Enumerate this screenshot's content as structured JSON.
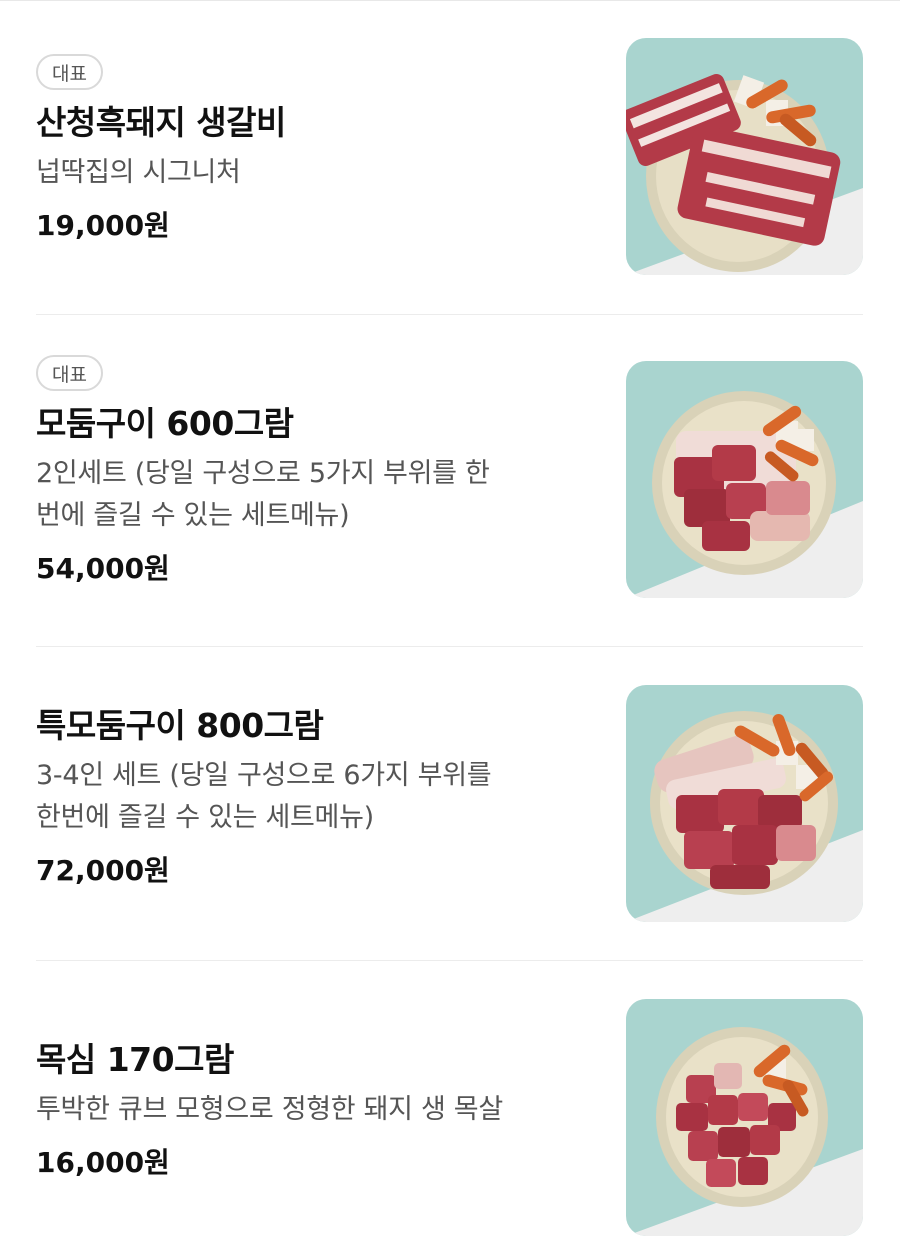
{
  "menu": {
    "badge_label": "대표",
    "items": [
      {
        "name": "산청흑돼지 생갈비",
        "description": "넙딱집의 시그니처",
        "description_line2": "",
        "price": "19,000원",
        "featured": true,
        "image_icon": "pork-ribs-plate-photo"
      },
      {
        "name": "모둠구이 600그람",
        "description": "2인세트 (당일 구성으로 5가지 부위를 한",
        "description_line2": "번에 즐길 수 있는 세트메뉴)",
        "price": "54,000원",
        "featured": true,
        "image_icon": "assorted-pork-plate-photo"
      },
      {
        "name": "특모둠구이 800그람",
        "description": "3-4인 세트 (당일 구성으로 6가지 부위를",
        "description_line2": "한번에 즐길 수 있는 세트메뉴)",
        "price": "72,000원",
        "featured": false,
        "image_icon": "special-assorted-pork-plate-photo"
      },
      {
        "name": "목심 170그람",
        "description": "투박한 큐브 모형으로 정형한 돼지 생 목살",
        "description_line2": "",
        "price": "16,000원",
        "featured": false,
        "image_icon": "pork-neck-cubes-plate-photo"
      }
    ]
  },
  "colors": {
    "photo_background_teal": "#a9d4cf",
    "photo_background_white": "#eeeeee",
    "plate_rim": "#d9d2b8",
    "meat_red": "#b33a48",
    "sausage_orange": "#d9682a"
  }
}
